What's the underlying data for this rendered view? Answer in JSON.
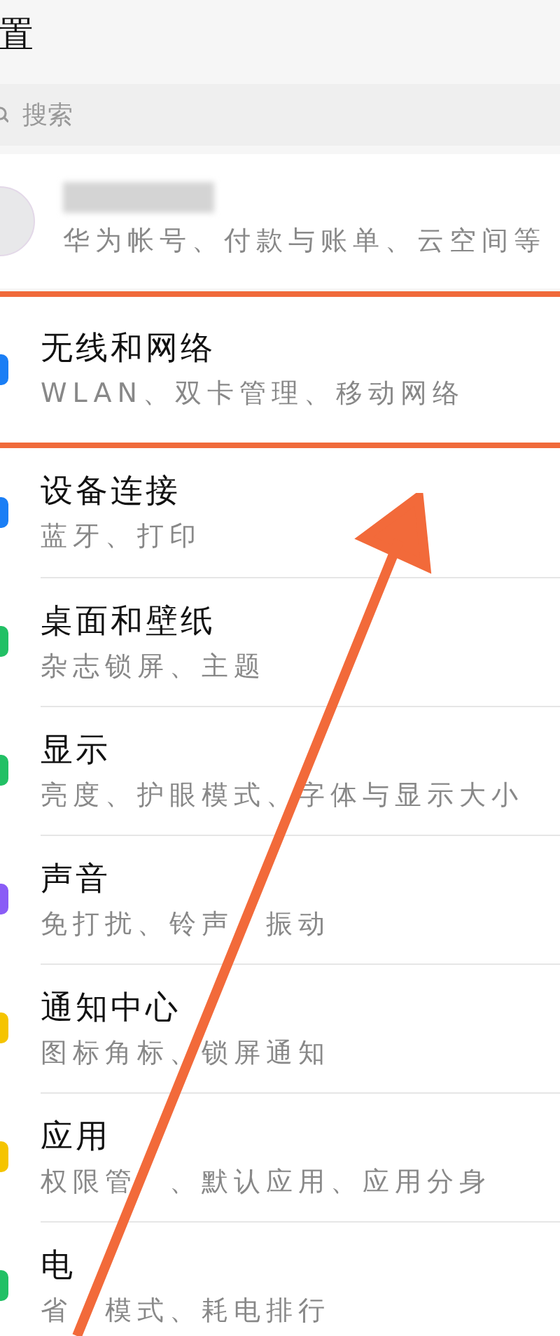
{
  "header": {
    "title": "置"
  },
  "search": {
    "placeholder": "搜索"
  },
  "account": {
    "subtitle": "华为帐号、付款与账单、云空间等"
  },
  "items": [
    {
      "title": "无线和网络",
      "subtitle": [
        "WLAN、双卡管理、移动网络"
      ],
      "color": "#1a7ef5",
      "highlighted": true
    },
    {
      "title": "设备连接",
      "subtitle": [
        "蓝牙、打印"
      ],
      "color": "#1a7ef5",
      "highlighted": false
    },
    {
      "title": "桌面和壁纸",
      "subtitle": [
        "杂志锁屏、主题"
      ],
      "color": "#22c065",
      "highlighted": false
    },
    {
      "title": "显示",
      "subtitle": [
        "亮度、护眼模式、字体与显示大小"
      ],
      "color": "#22c065",
      "highlighted": false
    },
    {
      "title": "声音",
      "subtitle": [
        "免打扰、铃声",
        "振动"
      ],
      "color": "#8a5cf6",
      "highlighted": false
    },
    {
      "title": "通知中心",
      "subtitle": [
        "图标角标、锁屏通知"
      ],
      "color": "#f5c400",
      "highlighted": false
    },
    {
      "title": "应用",
      "subtitle": [
        "权限管",
        "、默认应用、应用分身"
      ],
      "color": "#f5c400",
      "highlighted": false
    },
    {
      "title": "电",
      "subtitle": [
        "省",
        "模式、耗电排行"
      ],
      "color": "#22c065",
      "highlighted": false
    }
  ]
}
